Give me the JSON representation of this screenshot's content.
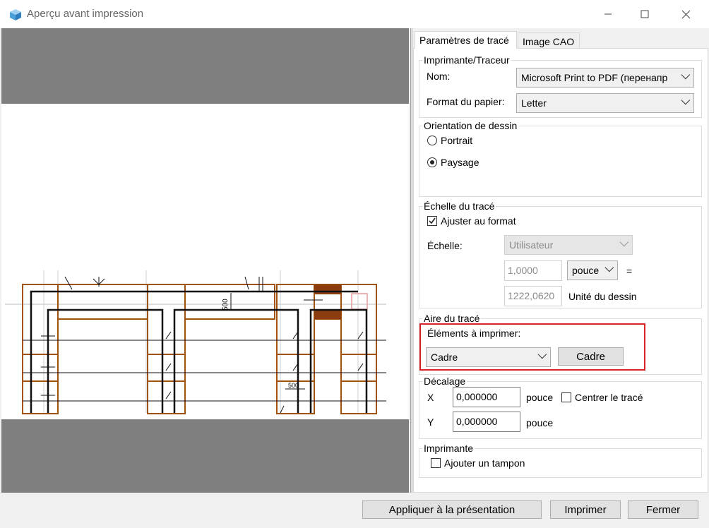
{
  "window": {
    "title": "Aperçu avant impression"
  },
  "tabs": [
    {
      "label": "Paramètres de tracé"
    },
    {
      "label": "Image CAO"
    }
  ],
  "printer_group": {
    "title": "Imprimante/Traceur",
    "name_label": "Nom:",
    "name_value": "Microsoft Print to PDF (перенапр",
    "paper_label": "Format du papier:",
    "paper_value": "Letter"
  },
  "orientation_group": {
    "title": "Orientation de dessin",
    "portrait": "Portrait",
    "landscape": "Paysage",
    "selected": "Paysage"
  },
  "scale_group": {
    "title": "Échelle du tracé",
    "fit_label": "Ajuster au format",
    "fit_checked": true,
    "scale_label": "Échelle:",
    "scale_value": "Utilisateur",
    "ratio_value": "1,0000",
    "unit_value": "pouce",
    "equals": "=",
    "drawing_value": "1222,0620",
    "drawing_unit_label": "Unité du dessin"
  },
  "area_group": {
    "title": "Aire du tracé",
    "elements_label": "Éléments à imprimer:",
    "elements_value": "Cadre",
    "frame_button": "Cadre"
  },
  "offset_group": {
    "title": "Décalage",
    "x_label": "X",
    "x_value": "0,000000",
    "x_unit": "pouce",
    "center_label": "Centrer le tracé",
    "y_label": "Y",
    "y_value": "0,000000",
    "y_unit": "pouce"
  },
  "stamp_group": {
    "title": "Imprimante",
    "stamp_label": "Ajouter un tampon"
  },
  "buttons": {
    "apply": "Appliquer à la présentation",
    "print": "Imprimer",
    "close": "Fermer"
  },
  "drawing_annotations": {
    "dim1": "500",
    "dim2": "500"
  },
  "colors": {
    "highlight": "#d9232b",
    "frame_brown": "#a0520f",
    "preview_gray": "#7f7f7f"
  }
}
